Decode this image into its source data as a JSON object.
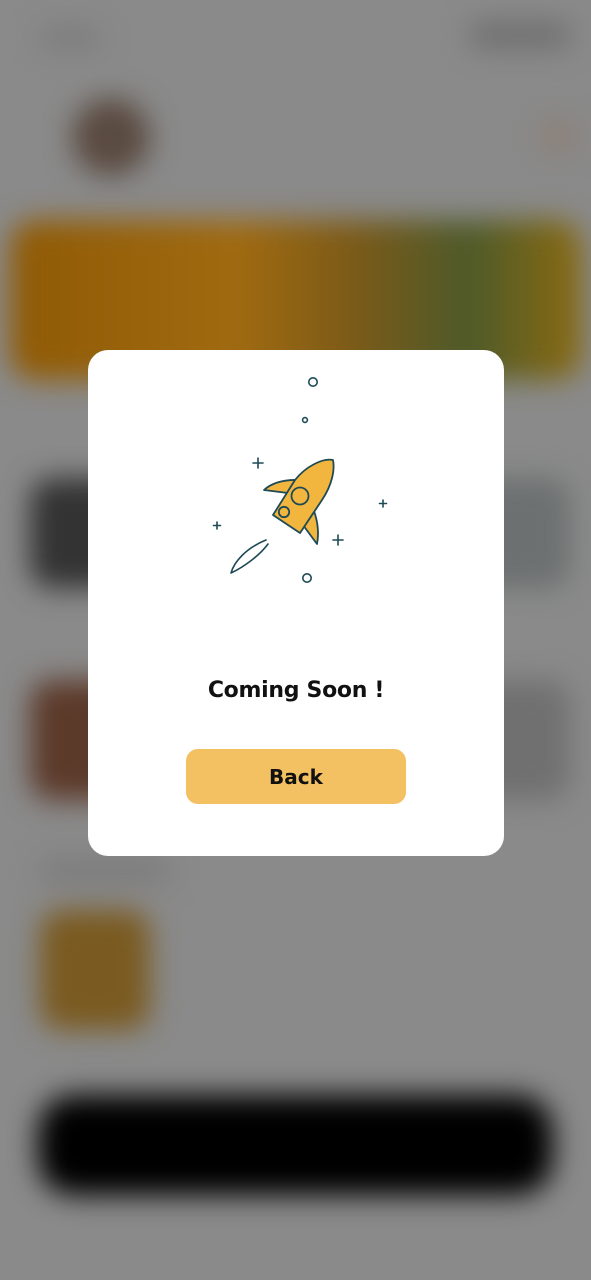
{
  "dialog": {
    "title": "Coming Soon !",
    "back_label": "Back",
    "illustration_icon": "rocket-icon"
  },
  "colors": {
    "accent": "#f4c162",
    "rocket_fill": "#f2b63f",
    "outline": "#1e4a55",
    "overlay": "#8a8a8a"
  }
}
